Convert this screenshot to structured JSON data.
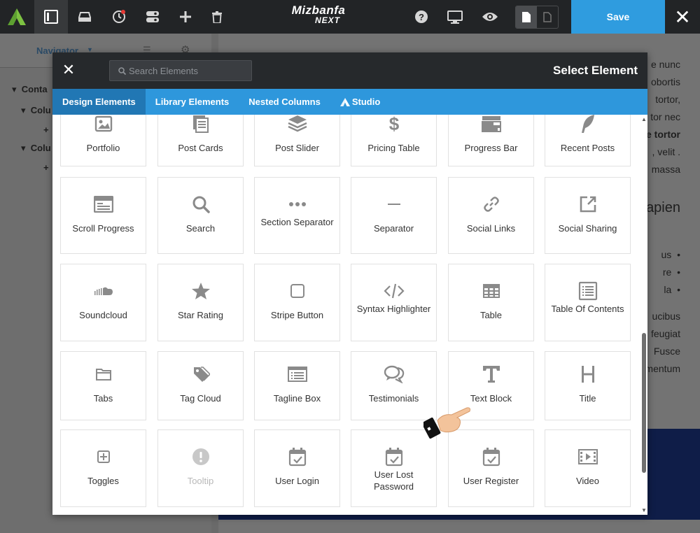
{
  "toolbar": {
    "brand_line1": "Mizbanfa",
    "brand_line2": "NEXT",
    "save_label": "Save",
    "close_label": "✕",
    "accent": "#2f9cdf"
  },
  "navigator": {
    "title": "Navigator",
    "tree": [
      "Conta",
      "Colu",
      "Colu"
    ]
  },
  "background_text": [
    "e nunc",
    "obortis",
    "tortor,",
    "tor nec",
    "e tortor",
    ", velit .",
    "massa",
    "apien",
    "us",
    "re",
    "la",
    "ucibus",
    "feugiat",
    "Fusce",
    "mentum"
  ],
  "modal": {
    "close_label": "✕",
    "search_placeholder": "Search Elements",
    "title": "Select Element",
    "tabs": [
      {
        "label": "Design Elements",
        "active": true
      },
      {
        "label": "Library Elements",
        "active": false
      },
      {
        "label": "Nested Columns",
        "active": false
      },
      {
        "label": "Studio",
        "active": false,
        "icon": "studio-logo-icon"
      }
    ],
    "elements": [
      {
        "label": "Portfolio",
        "icon": "portfolio-icon"
      },
      {
        "label": "Post Cards",
        "icon": "post-cards-icon"
      },
      {
        "label": "Post Slider",
        "icon": "post-slider-icon"
      },
      {
        "label": "Pricing Table",
        "icon": "dollar-icon"
      },
      {
        "label": "Progress Bar",
        "icon": "progress-bar-icon"
      },
      {
        "label": "Recent Posts",
        "icon": "feather-icon"
      },
      {
        "label": "Scroll Progress",
        "icon": "scroll-progress-icon"
      },
      {
        "label": "Search",
        "icon": "search-icon"
      },
      {
        "label": "Section Separator",
        "icon": "dots-icon"
      },
      {
        "label": "Separator",
        "icon": "separator-icon"
      },
      {
        "label": "Social Links",
        "icon": "link-icon"
      },
      {
        "label": "Social Sharing",
        "icon": "share-icon"
      },
      {
        "label": "Soundcloud",
        "icon": "soundcloud-icon"
      },
      {
        "label": "Star Rating",
        "icon": "star-icon"
      },
      {
        "label": "Stripe Button",
        "icon": "square-icon"
      },
      {
        "label": "Syntax Highlighter",
        "icon": "code-icon"
      },
      {
        "label": "Table",
        "icon": "table-icon"
      },
      {
        "label": "Table Of Contents",
        "icon": "list-icon"
      },
      {
        "label": "Tabs",
        "icon": "folder-icon"
      },
      {
        "label": "Tag Cloud",
        "icon": "tags-icon"
      },
      {
        "label": "Tagline Box",
        "icon": "tagline-box-icon"
      },
      {
        "label": "Testimonials",
        "icon": "comments-icon"
      },
      {
        "label": "Text Block",
        "icon": "text-t-icon"
      },
      {
        "label": "Title",
        "icon": "heading-h-icon"
      },
      {
        "label": "Toggles",
        "icon": "plus-square-icon"
      },
      {
        "label": "Tooltip",
        "icon": "exclamation-circle-icon",
        "disabled": true
      },
      {
        "label": "User Login",
        "icon": "calendar-check-icon"
      },
      {
        "label": "User Lost Password",
        "icon": "calendar-check-icon"
      },
      {
        "label": "User Register",
        "icon": "calendar-check-icon"
      },
      {
        "label": "Video",
        "icon": "film-icon"
      }
    ]
  }
}
